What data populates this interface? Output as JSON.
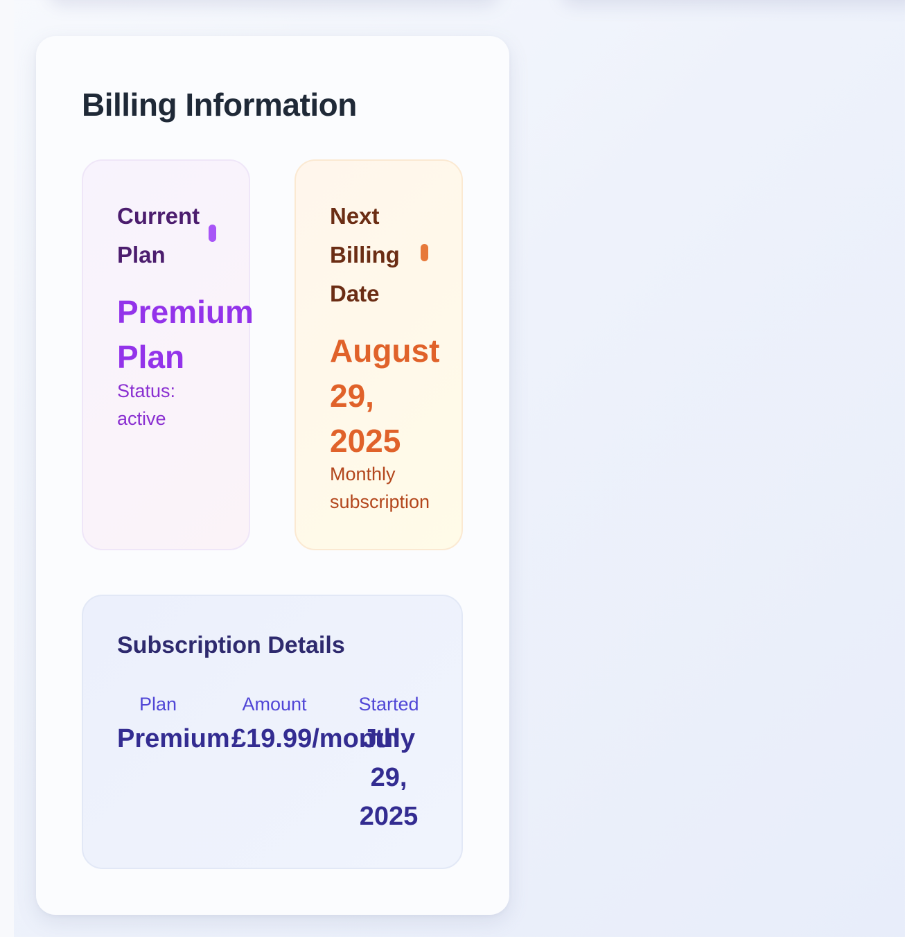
{
  "billing": {
    "title": "Billing Information",
    "current_plan": {
      "label": "Current Plan",
      "value": "Premium Plan",
      "status": "Status: active",
      "accent": "#9333ea"
    },
    "next_billing": {
      "label": "Next Billing Date",
      "value": "August 29, 2025",
      "note": "Monthly subscription",
      "accent": "#e0622a"
    },
    "subscription_details": {
      "title": "Subscription Details",
      "columns": [
        {
          "label": "Plan",
          "value": "Premium"
        },
        {
          "label": "Amount",
          "value": "£19.99/month"
        },
        {
          "label": "Started",
          "value": "July 29, 2025"
        }
      ]
    }
  }
}
